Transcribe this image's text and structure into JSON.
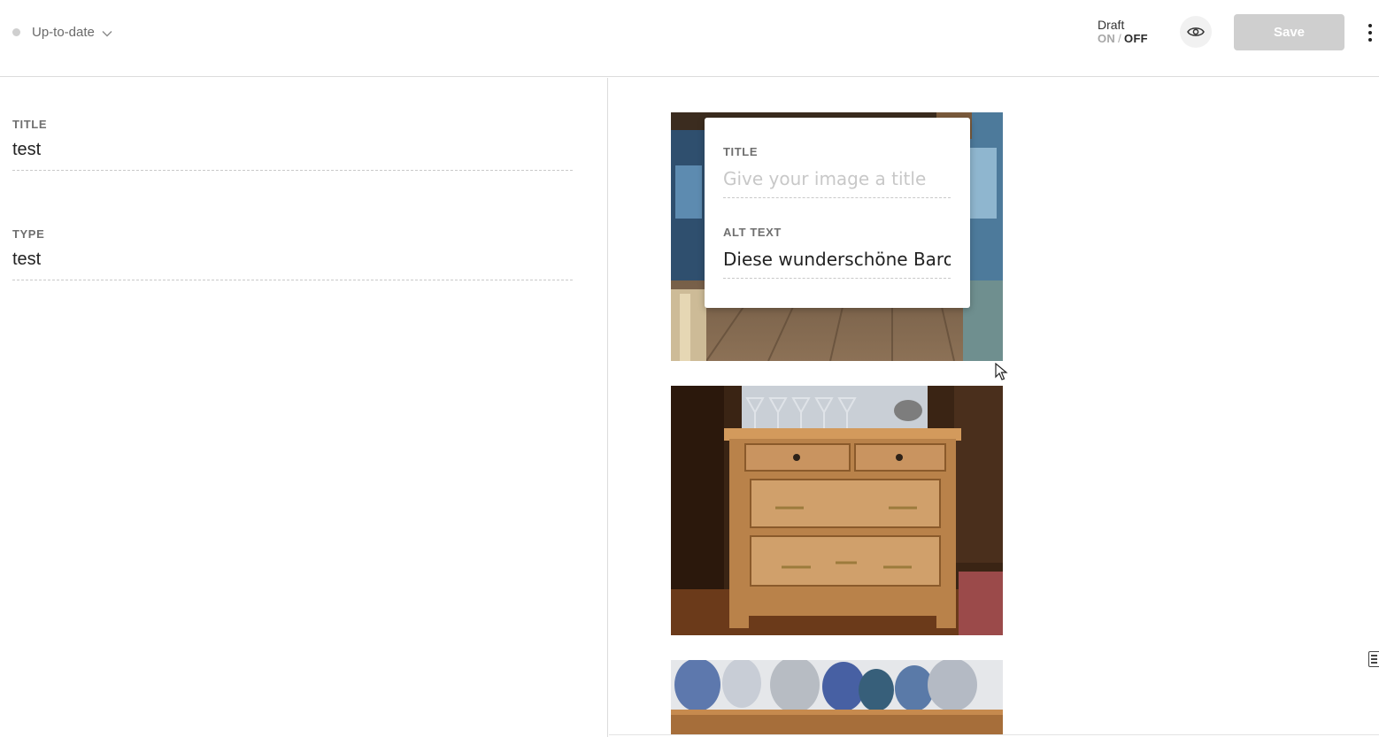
{
  "header": {
    "status_label": "Up-to-date",
    "draft_label": "Draft",
    "draft_on": "ON",
    "draft_separator": "/",
    "draft_off": "OFF",
    "save_label": "Save",
    "icons": [
      "status-dot-icon",
      "chevron-down-icon",
      "eye-icon",
      "more-vertical-icon"
    ]
  },
  "form": {
    "title_label": "TITLE",
    "title_value": "test",
    "type_label": "TYPE",
    "type_value": "test"
  },
  "image_popover": {
    "title_label": "TITLE",
    "title_placeholder": "Give your image a title",
    "title_value": "",
    "alt_label": "ALT TEXT",
    "alt_value": "Diese wunderschöne Baroktr"
  },
  "colors": {
    "save_disabled": "#cfcfcf",
    "status_dot": "#cfcfcf",
    "divider": "#dcdcdc"
  }
}
